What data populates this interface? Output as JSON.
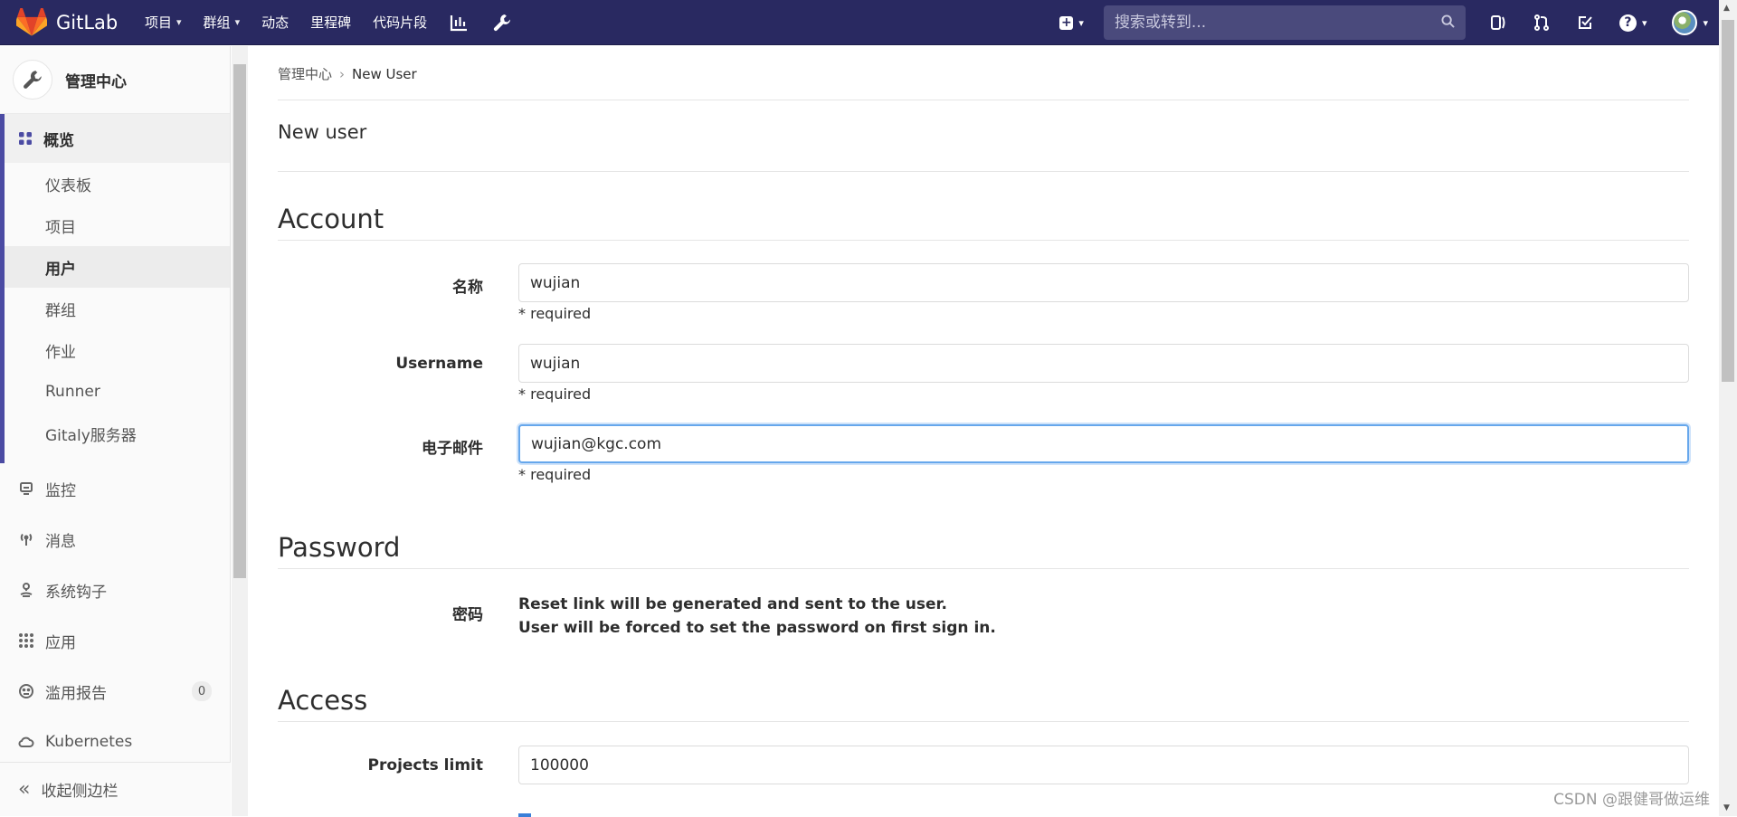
{
  "nav": {
    "brand": "GitLab",
    "items": [
      "项目",
      "群组",
      "动态",
      "里程碑",
      "代码片段"
    ],
    "search_placeholder": "搜索或转到..."
  },
  "sidebar": {
    "context_title": "管理中心",
    "section": "概览",
    "sub_items": [
      "仪表板",
      "项目",
      "用户",
      "群组",
      "作业",
      "Runner",
      "Gitaly服务器"
    ],
    "items": [
      {
        "label": "监控",
        "icon": "monitor-icon"
      },
      {
        "label": "消息",
        "icon": "broadcast-icon"
      },
      {
        "label": "系统钩子",
        "icon": "hook-icon"
      },
      {
        "label": "应用",
        "icon": "apps-icon"
      },
      {
        "label": "滥用报告",
        "icon": "face-icon",
        "badge": "0"
      },
      {
        "label": "Kubernetes",
        "icon": "cloud-icon"
      }
    ],
    "collapse": "收起侧边栏"
  },
  "breadcrumb": {
    "root": "管理中心",
    "current": "New User"
  },
  "page_title": "New user",
  "sections": {
    "account": "Account",
    "password": "Password",
    "access": "Access"
  },
  "fields": {
    "name": {
      "label": "名称",
      "value": "wujian",
      "help": "* required"
    },
    "username": {
      "label": "Username",
      "value": "wujian",
      "help": "* required"
    },
    "email": {
      "label": "电子邮件",
      "value": "wujian@kgc.com",
      "help": "* required"
    },
    "password": {
      "label": "密码",
      "line1": "Reset link will be generated and sent to the user.",
      "line2": "User will be forced to set the password on first sign in."
    },
    "projects_limit": {
      "label": "Projects limit",
      "value": "100000"
    }
  },
  "watermark": "CSDN @跟健哥做运维"
}
